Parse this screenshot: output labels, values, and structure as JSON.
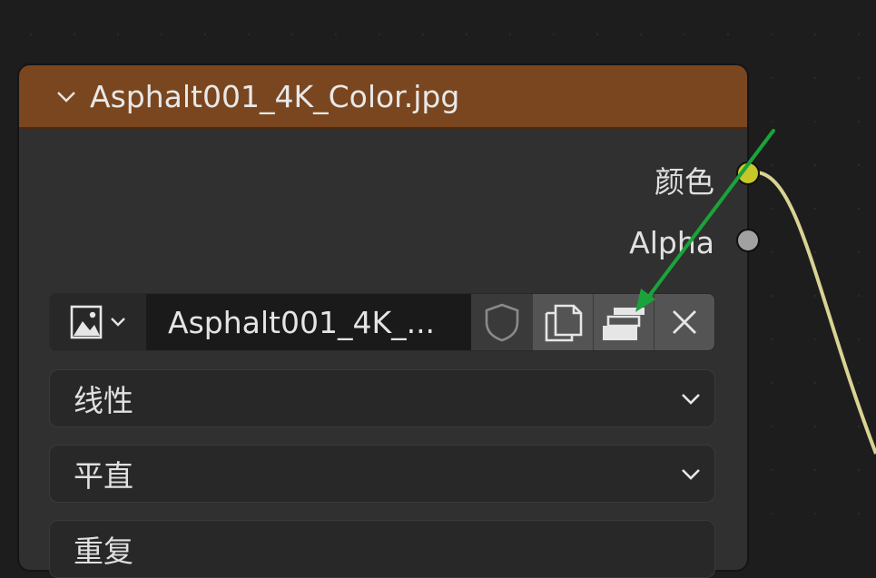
{
  "node": {
    "title": "Asphalt001_4K_Color.jpg",
    "header_color": "#7a461f"
  },
  "outputs": [
    {
      "label": "颜色",
      "socket_color": "#c7c729"
    },
    {
      "label": "Alpha",
      "socket_color": "#a1a1a1"
    }
  ],
  "image_row": {
    "picker_icon": "image-icon",
    "image_name": "Asphalt001_4K_...",
    "buttons": [
      "fake-user-shield-icon",
      "duplicate-icon",
      "pack-icon",
      "close-icon"
    ]
  },
  "dropdowns": {
    "interpolation": "线性",
    "projection": "平直",
    "extension": "重复"
  },
  "annotation": {
    "arrow_color": "#1aa33a"
  },
  "link_color": "#d9d394"
}
